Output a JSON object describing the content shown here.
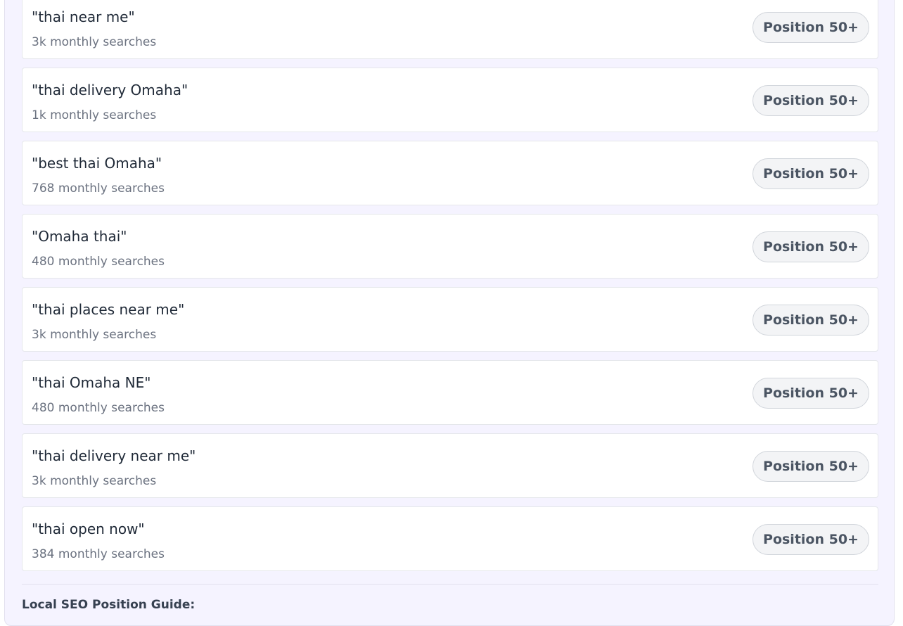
{
  "keywords": [
    {
      "keyword": "\"thai near me\"",
      "volume": "3k monthly searches",
      "position": "Position 50+"
    },
    {
      "keyword": "\"thai delivery Omaha\"",
      "volume": "1k monthly searches",
      "position": "Position 50+"
    },
    {
      "keyword": "\"best thai Omaha\"",
      "volume": "768 monthly searches",
      "position": "Position 50+"
    },
    {
      "keyword": "\"Omaha thai\"",
      "volume": "480 monthly searches",
      "position": "Position 50+"
    },
    {
      "keyword": "\"thai places near me\"",
      "volume": "3k monthly searches",
      "position": "Position 50+"
    },
    {
      "keyword": "\"thai Omaha NE\"",
      "volume": "480 monthly searches",
      "position": "Position 50+"
    },
    {
      "keyword": "\"thai delivery near me\"",
      "volume": "3k monthly searches",
      "position": "Position 50+"
    },
    {
      "keyword": "\"thai open now\"",
      "volume": "384 monthly searches",
      "position": "Position 50+"
    }
  ],
  "guide": {
    "title": "Local SEO Position Guide:"
  }
}
